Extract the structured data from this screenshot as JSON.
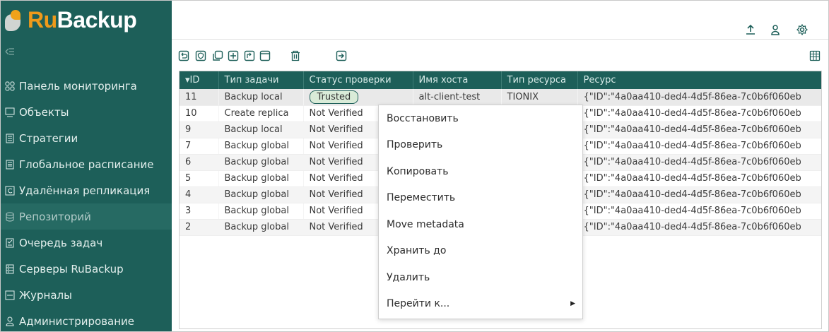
{
  "brand": {
    "name_part1": "Ru",
    "name_part2": "Backup",
    "accent": "#ef9a1a",
    "sidebar_color": "#1d5f59"
  },
  "sidebar": {
    "items": [
      {
        "label": "Панель мониторинга",
        "icon": "dashboard-icon"
      },
      {
        "label": "Объекты",
        "icon": "monitor-icon"
      },
      {
        "label": "Стратегии",
        "icon": "document-icon"
      },
      {
        "label": "Глобальное расписание",
        "icon": "schedule-icon"
      },
      {
        "label": "Удалённая репликация",
        "icon": "replication-icon"
      },
      {
        "label": "Репозиторий",
        "icon": "database-icon",
        "active": true
      },
      {
        "label": "Очередь задач",
        "icon": "checklist-icon"
      },
      {
        "label": "Серверы RuBackup",
        "icon": "server-icon"
      },
      {
        "label": "Журналы",
        "icon": "log-icon"
      },
      {
        "label": "Администрирование",
        "icon": "user-admin-icon"
      }
    ]
  },
  "table": {
    "columns": [
      "▾ID",
      "Тип задачи",
      "Статус проверки",
      "Имя хоста",
      "Тип ресурса",
      "Ресурс"
    ],
    "rows": [
      {
        "id": "11",
        "type": "Backup local",
        "status": "Trusted",
        "host": "alt-client-test",
        "rtype": "TIONIX",
        "resource": "{\"ID\":\"4a0aa410-ded4-4d5f-86ea-7c0b6f060eb"
      },
      {
        "id": "10",
        "type": "Create replica",
        "status": "Not Verified",
        "host": "",
        "rtype": "",
        "resource": "{\"ID\":\"4a0aa410-ded4-4d5f-86ea-7c0b6f060eb"
      },
      {
        "id": "9",
        "type": "Backup local",
        "status": "Not Verified",
        "host": "",
        "rtype": "",
        "resource": "{\"ID\":\"4a0aa410-ded4-4d5f-86ea-7c0b6f060eb"
      },
      {
        "id": "7",
        "type": "Backup global",
        "status": "Not Verified",
        "host": "",
        "rtype": "",
        "resource": "{\"ID\":\"4a0aa410-ded4-4d5f-86ea-7c0b6f060eb"
      },
      {
        "id": "6",
        "type": "Backup global",
        "status": "Not Verified",
        "host": "",
        "rtype": "",
        "resource": "{\"ID\":\"4a0aa410-ded4-4d5f-86ea-7c0b6f060eb"
      },
      {
        "id": "5",
        "type": "Backup global",
        "status": "Not Verified",
        "host": "",
        "rtype": "",
        "resource": "{\"ID\":\"4a0aa410-ded4-4d5f-86ea-7c0b6f060eb"
      },
      {
        "id": "4",
        "type": "Backup global",
        "status": "Not Verified",
        "host": "",
        "rtype": "",
        "resource": "{\"ID\":\"4a0aa410-ded4-4d5f-86ea-7c0b6f060eb"
      },
      {
        "id": "3",
        "type": "Backup global",
        "status": "Not Verified",
        "host": "",
        "rtype": "",
        "resource": "{\"ID\":\"4a0aa410-ded4-4d5f-86ea-7c0b6f060eb"
      },
      {
        "id": "2",
        "type": "Backup global",
        "status": "Not Verified",
        "host": "",
        "rtype": "",
        "resource": "{\"ID\":\"4a0aa410-ded4-4d5f-86ea-7c0b6f060eb"
      }
    ]
  },
  "context_menu": {
    "items": [
      "Восстановить",
      "Проверить",
      "Копировать",
      "Переместить",
      "Move metadata",
      "Хранить до",
      "Удалить",
      "Перейти к..."
    ]
  },
  "topbar_icons": [
    "upload-icon",
    "user-icon",
    "settings-icon"
  ],
  "toolbar_icons": [
    "restore-icon",
    "verify-icon",
    "copy-icon",
    "move-icon",
    "metadata-icon",
    "keep-until-icon",
    "delete-icon",
    "goto-icon",
    "table-settings-icon"
  ]
}
